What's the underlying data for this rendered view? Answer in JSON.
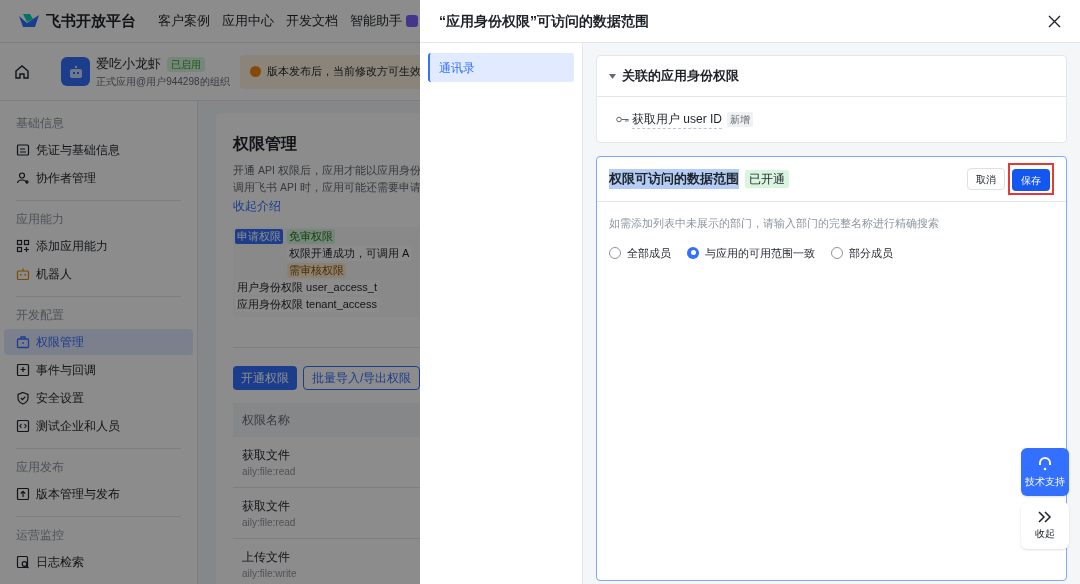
{
  "topnav": {
    "brand": "飞书开放平台",
    "links": [
      "客户案例",
      "应用中心",
      "开发文档",
      "智能助手"
    ]
  },
  "appbar": {
    "app_name": "爱吃小龙虾",
    "status": "已启用",
    "org": "正式应用@用户944298的组织",
    "notice": "版本发布后，当前修改方可生效"
  },
  "sidebar": {
    "groups": [
      {
        "title": "基础信息",
        "items": [
          {
            "label": "凭证与基础信息",
            "selected": false
          },
          {
            "label": "协作者管理",
            "selected": false
          }
        ]
      },
      {
        "title": "应用能力",
        "items": [
          {
            "label": "添加应用能力",
            "selected": false
          },
          {
            "label": "机器人",
            "selected": false
          }
        ]
      },
      {
        "title": "开发配置",
        "items": [
          {
            "label": "权限管理",
            "selected": true
          },
          {
            "label": "事件与回调",
            "selected": false
          },
          {
            "label": "安全设置",
            "selected": false
          },
          {
            "label": "测试企业和人员",
            "selected": false
          }
        ]
      },
      {
        "title": "应用发布",
        "items": [
          {
            "label": "版本管理与发布",
            "selected": false
          }
        ]
      },
      {
        "title": "运营监控",
        "items": [
          {
            "label": "日志检索",
            "selected": false
          }
        ]
      }
    ]
  },
  "content": {
    "title": "权限管理",
    "intro": [
      "开通 API 权限后，应用才能以应用身份",
      "调用飞书 API 时，应用可能还需要申请"
    ],
    "collapse_link": "收起介绍",
    "diagram": {
      "apply": "申请权限",
      "free": "免审权限",
      "success": "权限开通成功，可调用 A",
      "review": "需审核权限",
      "user_token": "用户身份权限",
      "user_token_code": "user_access_t",
      "tenant_token": "应用身份权限",
      "tenant_token_code": "tenant_access"
    },
    "buttons": [
      "开通权限",
      "批量导入/导出权限"
    ],
    "table": {
      "columns": [
        "权限名称"
      ],
      "rows": [
        {
          "name": "获取文件",
          "scope": "aily:file:read"
        },
        {
          "name": "获取文件",
          "scope": "aily:file:read"
        },
        {
          "name": "上传文件",
          "scope": "aily:file:write"
        }
      ]
    }
  },
  "drawer": {
    "title": "“应用身份权限”可访问的数据范围",
    "nav": [
      {
        "label": "通讯录",
        "selected": true
      }
    ],
    "related": {
      "title": "关联的应用身份权限",
      "expanded": true,
      "items": [
        {
          "label": "获取用户 user ID",
          "tag": "新增"
        }
      ]
    },
    "scope": {
      "title": "权限可访问的数据范围",
      "title_highlighted": true,
      "status": "已开通",
      "cancel": "取消",
      "save": "保存",
      "save_annotated": true,
      "hint": "如需添加列表中未展示的部门，请输入部门的完整名称进行精确搜索",
      "options": [
        {
          "label": "全部成员",
          "selected": false
        },
        {
          "label": "与应用的可用范围一致",
          "selected": true
        },
        {
          "label": "部分成员",
          "selected": false
        }
      ]
    }
  },
  "float": {
    "support": "技术支持",
    "collapse": "收起"
  }
}
